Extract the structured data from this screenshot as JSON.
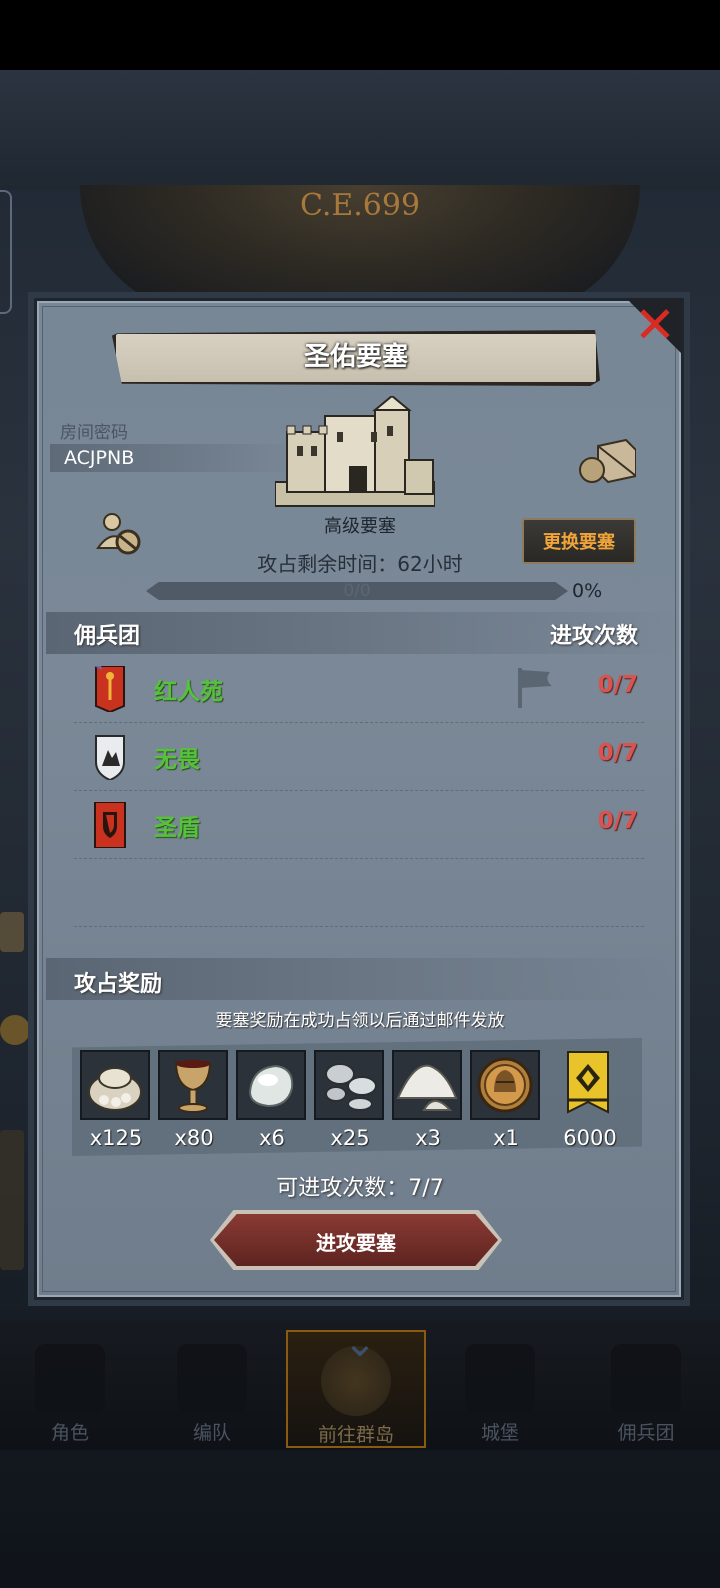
{
  "background": {
    "era_text": "C.E.699"
  },
  "bottom_nav": {
    "items": [
      {
        "label": "角色",
        "icon": "knight-icon",
        "active": false
      },
      {
        "label": "编队",
        "icon": "helmet-icon",
        "active": false
      },
      {
        "label": "前往群岛",
        "icon": "compass-icon",
        "active": true
      },
      {
        "label": "城堡",
        "icon": "castle-icon",
        "active": false
      },
      {
        "label": "佣兵团",
        "icon": "mercenary-icon",
        "active": false
      }
    ]
  },
  "modal": {
    "title": "圣佑要塞",
    "room_label": "房间密码",
    "room_code": "ACJPNB",
    "fortress_level": "高级要塞",
    "change_button": "更换要塞",
    "remaining_label": "攻占剩余时间：",
    "remaining_value": "62",
    "remaining_unit": "小时",
    "progress_text": "0/0",
    "progress_percent": "0%",
    "progress_fraction": 0,
    "mercenary_header": "佣兵团",
    "attack_count_header": "进攻次数",
    "clans": [
      {
        "name": "红人苑",
        "count": "0/7",
        "banner": "red-banner-icon",
        "flag": true
      },
      {
        "name": "无畏",
        "count": "0/7",
        "banner": "white-shield-icon",
        "flag": false
      },
      {
        "name": "圣盾",
        "count": "0/7",
        "banner": "red-shield-banner-icon",
        "flag": false
      }
    ],
    "reward_header": "攻占奖励",
    "reward_note": "要塞奖励在成功占领以后通过邮件发放",
    "rewards": [
      {
        "icon": "coin-sack-icon",
        "qty": "x125"
      },
      {
        "icon": "goblet-icon",
        "qty": "x80"
      },
      {
        "icon": "gemstone-icon",
        "qty": "x6"
      },
      {
        "icon": "silver-ore-icon",
        "qty": "x25"
      },
      {
        "icon": "salt-pile-icon",
        "qty": "x3"
      },
      {
        "icon": "helmet-medal-icon",
        "qty": "x1"
      },
      {
        "icon": "honor-banner-icon",
        "qty": "6000"
      }
    ],
    "available_label": "可进攻次数：",
    "available_value": "7/7",
    "attack_button": "进攻要塞"
  },
  "colors": {
    "clan_name": "#55c23a",
    "attack_count": "#d9534f",
    "change_button_text": "#f0a43a",
    "close": "#d92b22"
  }
}
